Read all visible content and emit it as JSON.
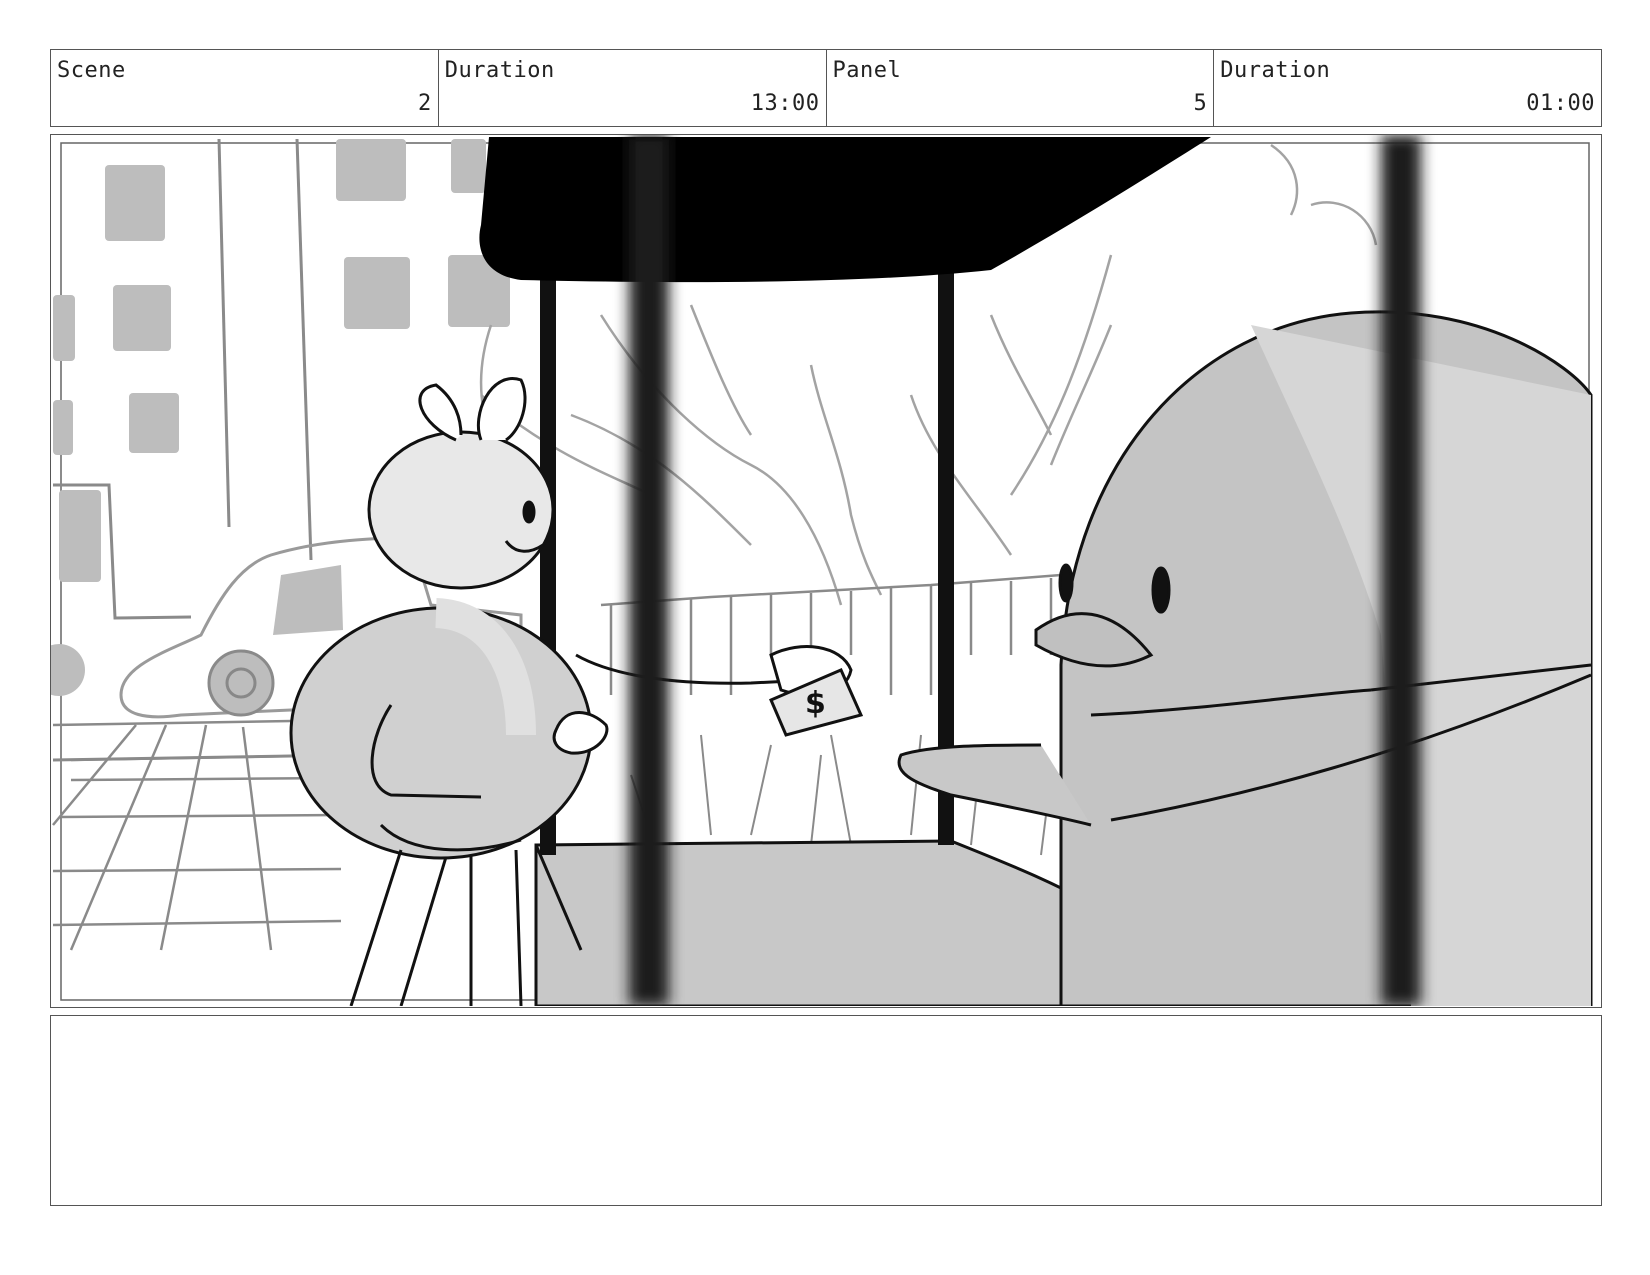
{
  "header": {
    "scene": {
      "label": "Scene",
      "value": "2"
    },
    "scene_duration": {
      "label": "Duration",
      "value": "13:00"
    },
    "panel": {
      "label": "Panel",
      "value": "5"
    },
    "panel_duration": {
      "label": "Duration",
      "value": "01:00"
    }
  },
  "notes": {
    "text": ""
  },
  "colors": {
    "ink": "#111111",
    "tone_light": "#e6e6e6",
    "tone_mid": "#c4c4c4",
    "tone_dark": "#9a9a9a",
    "awning": "#000000",
    "bar": "#1e1e1e"
  }
}
